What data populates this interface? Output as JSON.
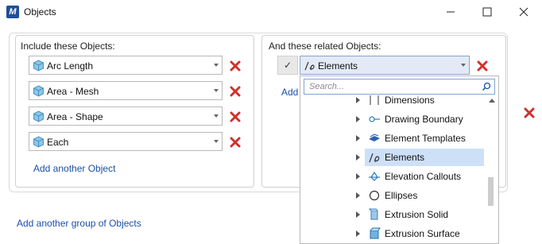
{
  "window": {
    "title": "Objects",
    "app_icon": "app-logo-icon"
  },
  "left_panel": {
    "label": "Include these Objects:",
    "items": [
      {
        "label": "Arc Length"
      },
      {
        "label": "Area - Mesh"
      },
      {
        "label": "Area - Shape"
      },
      {
        "label": "Each"
      }
    ],
    "add_link": "Add another Object"
  },
  "right_panel": {
    "label": "And these related Objects:",
    "selected": "Elements",
    "add_link_partial": "Add",
    "dropdown": {
      "search_placeholder": "Search...",
      "items": [
        {
          "label": "Dimensions",
          "icon": "dimensions-icon"
        },
        {
          "label": "Drawing Boundary",
          "icon": "drawing-boundary-icon"
        },
        {
          "label": "Element Templates",
          "icon": "element-templates-icon"
        },
        {
          "label": "Elements",
          "icon": "elements-icon",
          "selected": true
        },
        {
          "label": "Elevation Callouts",
          "icon": "elevation-callouts-icon"
        },
        {
          "label": "Ellipses",
          "icon": "ellipses-icon"
        },
        {
          "label": "Extrusion Solid",
          "icon": "extrusion-solid-icon"
        },
        {
          "label": "Extrusion Surface",
          "icon": "extrusion-surface-icon"
        }
      ]
    }
  },
  "footer": {
    "add_group_link": "Add another group of Objects"
  },
  "colors": {
    "accent_link": "#1a4ea8",
    "delete_red": "#d0312d",
    "selection": "#cde0f7"
  }
}
